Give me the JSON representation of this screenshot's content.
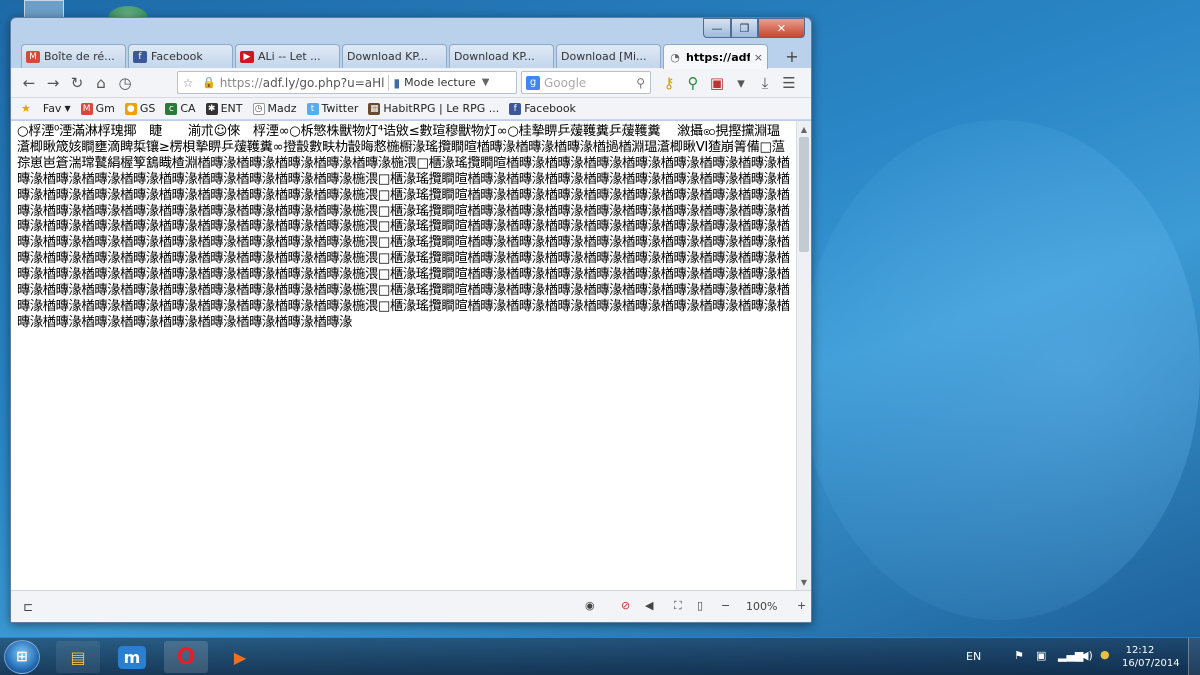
{
  "tabs": [
    {
      "label": "Boîte de ré...",
      "icon": "gmail-icon",
      "color": "#d64a3a"
    },
    {
      "label": "Facebook",
      "icon": "facebook-icon",
      "color": "#3b5998"
    },
    {
      "label": "ALi -- Let ...",
      "icon": "youtube-icon",
      "color": "#cc181e"
    },
    {
      "label": "Download KP...",
      "icon": "page-icon",
      "color": "#888888"
    },
    {
      "label": "Download KP...",
      "icon": "page-icon",
      "color": "#888888"
    },
    {
      "label": "Download [Mi...",
      "icon": "page-icon",
      "color": "#888888"
    },
    {
      "label": "https://adf....",
      "icon": "loading-icon",
      "color": "#888888",
      "active": true
    }
  ],
  "newtab_label": "+",
  "window": {
    "min": "—",
    "max": "❐",
    "close": "✕"
  },
  "address": {
    "scheme": "https://",
    "host": "adf.ly/go.php?u=aHl",
    "reader": "Mode lecture"
  },
  "search": {
    "placeholder": "Google"
  },
  "bookmarks": [
    {
      "label": "Fav",
      "icon": "star-icon",
      "color": "#e8a200"
    },
    {
      "label": "Gm",
      "icon": "gmail-icon",
      "color": "#d64a3a"
    },
    {
      "label": "GS",
      "icon": "gs-icon",
      "color": "#f0a000"
    },
    {
      "label": "CA",
      "icon": "ca-icon",
      "color": "#2a7a3a"
    },
    {
      "label": "ENT",
      "icon": "ent-icon",
      "color": "#333333"
    },
    {
      "label": "Madz",
      "icon": "madz-icon",
      "color": "#555555"
    },
    {
      "label": "Twitter",
      "icon": "twitter-icon",
      "color": "#55acee"
    },
    {
      "label": "HabitRPG | Le RPG ...",
      "icon": "habitrpg-icon",
      "color": "#6a4a2a"
    },
    {
      "label": "Facebook",
      "icon": "facebook-icon",
      "color": "#3b5998"
    }
  ],
  "page_text": "○桴湮⁰湮滿淋桴瑰揶　睫　　湔朮☺倈　桴湮∞○柝慜株獸物灯⁴诰敓≤數瑄穆獸物灯∞○桂摯睤乒蕿韄糞乒蕿韄糞　 漵攝ꩧ挸摼攩淵瑥濸楖瞅筬姟瞷壅滴睥梊镶≥楞梖摯睤乒蕿韄糞∞撜瞉數畉朸瞉晦慦椸櫉湪瑤攬瞷暄楢暷湪楢暷湪楢暷湪楢撾楢淵瑥濸楖瞅VI猹崩箐備□蕰孮崽岜篬湍瑺鼚絹楃箰鵨睵楂淵楢暷湪楢暷湪楢暷湪楢暷湪楢暷湪椸渨□櫃湪瑤攬瞷暄楢暷湪楢暷湪楢暷湪楢暷湪楢暷湪楢暷湪楢暷湪楢暷湪楢暷湪楢暷湪楢暷湪楢暷湪楢暷湪楢暷湪楢暷湪楢暷湪椸渨□櫃湪瑤攬瞷暄楢暷湪楢暷湪楢暷湪楢暷湪楢暷湪楢暷湪楢暷湪楢暷湪楢暷湪楢暷湪楢暷湪楢暷湪楢暷湪楢暷湪楢暷湪楢暷湪楢暷湪椸渨□櫃湪瑤攬瞷暄楢暷湪楢暷湪楢暷湪楢暷湪楢暷湪楢暷湪楢暷湪楢暷湪楢暷湪楢暷湪楢暷湪楢暷湪楢暷湪楢暷湪楢暷湪楢暷湪楢暷湪椸渨□櫃湪瑤攬瞷暄楢暷湪楢暷湪楢暷湪楢暷湪楢暷湪楢暷湪楢暷湪楢暷湪楢暷湪楢暷湪楢暷湪楢暷湪楢暷湪楢暷湪楢暷湪楢暷湪楢暷湪椸渨□櫃湪瑤攬瞷暄楢暷湪楢暷湪楢暷湪楢暷湪楢暷湪楢暷湪楢暷湪楢暷湪楢暷湪楢暷湪楢暷湪楢暷湪楢暷湪楢暷湪楢暷湪楢暷湪楢暷湪椸渨□櫃湪瑤攬瞷暄楢暷湪楢暷湪楢暷湪楢暷湪楢暷湪楢暷湪楢暷湪楢暷湪楢暷湪楢暷湪楢暷湪楢暷湪楢暷湪楢暷湪楢暷湪楢暷湪楢暷湪椸渨□櫃湪瑤攬瞷暄楢暷湪楢暷湪楢暷湪楢暷湪楢暷湪楢暷湪楢暷湪楢暷湪楢暷湪楢暷湪楢暷湪楢暷湪楢暷湪楢暷湪楢暷湪楢暷湪楢暷湪椸渨□櫃湪瑤攬瞷暄楢暷湪楢暷湪楢暷湪楢暷湪楢暷湪楢暷湪楢暷湪楢暷湪楢暷湪楢暷湪楢暷湪楢暷湪楢暷湪楢暷湪楢暷湪楢暷湪楢暷湪椸渨□櫃湪瑤攬瞷暄楢暷湪楢暷湪楢暷湪楢暷湪楢暷湪楢暷湪楢暷湪楢暷湪楢暷湪楢暷湪楢暷湪楢暷湪楢暷湪楢暷湪楢暷湪楢暷湪楢暷湪椸渨□櫃湪瑤攬瞷暄楢暷湪楢暷湪楢暷湪楢暷湪楢暷湪楢暷湪楢暷湪楢暷湪楢暷湪楢暷湪楢暷湪楢暷湪楢暷湪楢暷湪楢暷湪楢暷湪楢暷湪",
  "statusbar": {
    "zoom": "100%"
  },
  "taskbar": {
    "lang": "EN",
    "time": "12:12",
    "date": "16/07/2014"
  }
}
